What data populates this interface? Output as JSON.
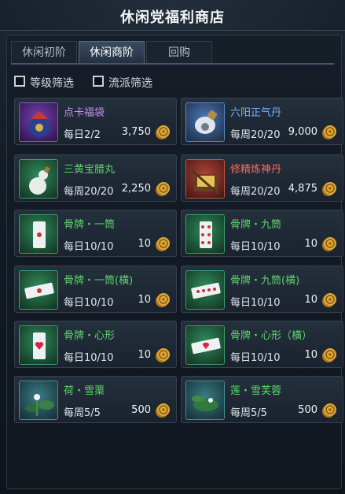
{
  "window": {
    "title": "休闲党福利商店"
  },
  "tabs": [
    {
      "label": "休闲初阶",
      "active": false
    },
    {
      "label": "休闲商阶",
      "active": true
    },
    {
      "label": "回购",
      "active": false
    }
  ],
  "filters": [
    {
      "label": "等级筛选",
      "checked": false
    },
    {
      "label": "流派筛选",
      "checked": false
    }
  ],
  "currency_icon": "coin-icon",
  "items": [
    {
      "name": "点卡福袋",
      "limit": "每日2/2",
      "price": "3,750",
      "quality": "purple",
      "icon": "lucky-bag-icon"
    },
    {
      "name": "六阳正气丹",
      "limit": "每周20/20",
      "price": "9,000",
      "quality": "blue",
      "icon": "pill-bottle-icon"
    },
    {
      "name": "三黄宝腊丸",
      "limit": "每周20/20",
      "price": "2,250",
      "quality": "green",
      "icon": "gourd-bottle-icon"
    },
    {
      "name": "修精炼神丹",
      "limit": "每周20/20",
      "price": "4,875",
      "quality": "red",
      "icon": "treasure-box-icon"
    },
    {
      "name": "骨牌・一筒",
      "limit": "每日10/10",
      "price": "10",
      "quality": "green",
      "icon": "domino-one-icon"
    },
    {
      "name": "骨牌・九筒",
      "limit": "每日10/10",
      "price": "10",
      "quality": "green",
      "icon": "domino-nine-icon"
    },
    {
      "name": "骨牌・一筒(横)",
      "limit": "每日10/10",
      "price": "10",
      "quality": "green",
      "icon": "domino-one-horizontal-icon"
    },
    {
      "name": "骨牌・九筒(横)",
      "limit": "每日10/10",
      "price": "10",
      "quality": "green",
      "icon": "domino-nine-horizontal-icon"
    },
    {
      "name": "骨牌・心形",
      "limit": "每日10/10",
      "price": "10",
      "quality": "green",
      "icon": "domino-heart-icon"
    },
    {
      "name": "骨牌・心形（横）",
      "limit": "每日10/10",
      "price": "10",
      "quality": "green",
      "icon": "domino-heart-horizontal-icon"
    },
    {
      "name": "荷・雪蕖",
      "limit": "每周5/5",
      "price": "500",
      "quality": "teal",
      "icon": "lotus-icon"
    },
    {
      "name": "莲・雪芙蓉",
      "limit": "每周5/5",
      "price": "500",
      "quality": "teal",
      "icon": "lotus-leaf-icon"
    }
  ]
}
